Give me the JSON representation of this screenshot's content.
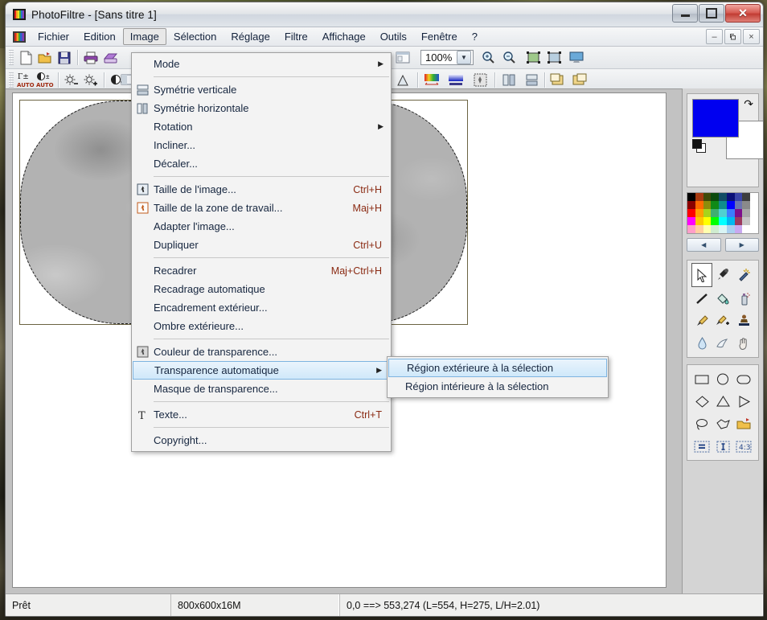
{
  "window": {
    "title": "PhotoFiltre - [Sans titre 1]",
    "logo_icon": "photofiltre-logo-icon",
    "controls": {
      "minimize": "minimize-icon",
      "maximize": "maximize-icon",
      "close": "close-icon"
    }
  },
  "mdi_controls": {
    "minimize": "–",
    "restore": "❐",
    "close": "×"
  },
  "menubar": {
    "items": [
      {
        "label": "Fichier",
        "active": false
      },
      {
        "label": "Edition",
        "active": false
      },
      {
        "label": "Image",
        "active": true
      },
      {
        "label": "Sélection",
        "active": false
      },
      {
        "label": "Réglage",
        "active": false
      },
      {
        "label": "Filtre",
        "active": false
      },
      {
        "label": "Affichage",
        "active": false
      },
      {
        "label": "Outils",
        "active": false
      },
      {
        "label": "Fenêtre",
        "active": false
      },
      {
        "label": "?",
        "active": false
      }
    ]
  },
  "toolbar_top": {
    "icons": [
      "new-file-icon",
      "open-folder-icon",
      "save-floppy-icon",
      "print-icon",
      "scanner-icon",
      "copy-icon",
      "paste-icon",
      "undo-icon",
      "redo-icon",
      "thumbnail-browser-icon"
    ],
    "zoom": {
      "value": "100%",
      "placeholder": "100%",
      "dropdown_icon": "chevron-down-icon"
    },
    "zoom_icons": [
      "zoom-in-icon",
      "zoom-out-icon",
      "fit-image-icon",
      "actual-size-icon",
      "fullscreen-icon"
    ]
  },
  "toolbar_bottom": {
    "icons": [
      "auto-levels-icon",
      "auto-contrast-icon",
      "brightness-down-icon",
      "brightness-up-icon",
      "contrast-icon",
      "grayscale-icon",
      "histogram-icon",
      "gradient-icon",
      "transparency-icon",
      "flip-horizontal-icon",
      "flip-vertical-icon",
      "rotate-left-icon",
      "rotate-right-icon"
    ]
  },
  "menu": {
    "title": "Image",
    "items": [
      {
        "label": "Mode",
        "icon": "",
        "accel": "",
        "submenu": true,
        "highlighted": false,
        "separator_after": true
      },
      {
        "label": "Symétrie verticale",
        "icon": "flip-vertical-icon",
        "accel": "",
        "submenu": false,
        "highlighted": false
      },
      {
        "label": "Symétrie horizontale",
        "icon": "flip-horizontal-icon",
        "accel": "",
        "submenu": false,
        "highlighted": false
      },
      {
        "label": "Rotation",
        "icon": "",
        "accel": "",
        "submenu": true,
        "highlighted": false
      },
      {
        "label": "Incliner...",
        "icon": "",
        "accel": "",
        "submenu": false,
        "highlighted": false
      },
      {
        "label": "Décaler...",
        "icon": "",
        "accel": "",
        "submenu": false,
        "highlighted": false,
        "separator_after": true
      },
      {
        "label": "Taille de l'image...",
        "icon": "image-size-icon",
        "accel": "Ctrl+H",
        "submenu": false,
        "highlighted": false
      },
      {
        "label": "Taille de la zone de travail...",
        "icon": "canvas-size-icon",
        "accel": "Maj+H",
        "submenu": false,
        "highlighted": false
      },
      {
        "label": "Adapter l'image...",
        "icon": "",
        "accel": "",
        "submenu": false,
        "highlighted": false
      },
      {
        "label": "Dupliquer",
        "icon": "",
        "accel": "Ctrl+U",
        "submenu": false,
        "highlighted": false,
        "separator_after": true
      },
      {
        "label": "Recadrer",
        "icon": "",
        "accel": "Maj+Ctrl+H",
        "submenu": false,
        "highlighted": false
      },
      {
        "label": "Recadrage automatique",
        "icon": "",
        "accel": "",
        "submenu": false,
        "highlighted": false
      },
      {
        "label": "Encadrement extérieur...",
        "icon": "",
        "accel": "",
        "submenu": false,
        "highlighted": false
      },
      {
        "label": "Ombre extérieure...",
        "icon": "",
        "accel": "",
        "submenu": false,
        "highlighted": false,
        "separator_after": true
      },
      {
        "label": "Couleur de transparence...",
        "icon": "transparency-color-icon",
        "accel": "",
        "submenu": false,
        "highlighted": false
      },
      {
        "label": "Transparence automatique",
        "icon": "",
        "accel": "",
        "submenu": true,
        "highlighted": true
      },
      {
        "label": "Masque de transparence...",
        "icon": "",
        "accel": "",
        "submenu": false,
        "highlighted": false,
        "separator_after": true
      },
      {
        "label": "Texte...",
        "icon": "text-tool-icon",
        "accel": "Ctrl+T",
        "submenu": false,
        "highlighted": false,
        "separator_after": true
      },
      {
        "label": "Copyright...",
        "icon": "",
        "accel": "",
        "submenu": false,
        "highlighted": false
      }
    ]
  },
  "submenu": {
    "parent": "Transparence automatique",
    "items": [
      {
        "label": "Région extérieure à la sélection",
        "highlighted": true
      },
      {
        "label": "Région intérieure à la sélection",
        "highlighted": false
      }
    ]
  },
  "colors": {
    "foreground": "#0000f0",
    "background": "#ffffff",
    "menu_highlight": "#cfe8fa",
    "menu_highlight_border": "#7eb4e0",
    "accel_text": "#8a2a12",
    "swap_icon": "swap-colors-icon",
    "reset_icon": "default-colors-icon",
    "palette": [
      "#000000",
      "#a83a10",
      "#3f4a08",
      "#0b4a0b",
      "#114c64",
      "#0b1078",
      "#3a44a8",
      "#3d3d3d",
      "#ffffff",
      "#8b0000",
      "#ff6a00",
      "#8d8d0b",
      "#0f8a16",
      "#0f8c8c",
      "#0000ff",
      "#6b74b0",
      "#8a8a8a",
      "#ffffff",
      "#ff0000",
      "#ffa000",
      "#a8d41b",
      "#3fae72",
      "#4fd0d0",
      "#3b7bff",
      "#7d0f8c",
      "#a8a8a8",
      "#ffffff",
      "#ff00ff",
      "#ffc800",
      "#ffff00",
      "#00ff00",
      "#00ffff",
      "#00b8f0",
      "#9c3a5f",
      "#c6c6c6",
      "#ffffff",
      "#ff9ec8",
      "#ffcfa0",
      "#ffffae",
      "#cfeccf",
      "#d9f4f4",
      "#a8cff0",
      "#c8a8f0",
      "#ffffff",
      "#ffffff"
    ],
    "nav_prev_icon": "arrow-left-icon",
    "nav_next_icon": "arrow-right-icon"
  },
  "tools": {
    "items": [
      {
        "name": "selection-arrow-tool",
        "glyph": "↖",
        "selected": true
      },
      {
        "name": "eyedropper-tool",
        "glyph": "✒",
        "selected": false
      },
      {
        "name": "magic-wand-tool",
        "glyph": "✨",
        "selected": false
      },
      {
        "name": "line-tool",
        "glyph": "╱",
        "selected": false
      },
      {
        "name": "paint-bucket-tool",
        "glyph": "◢",
        "selected": false
      },
      {
        "name": "spray-can-tool",
        "glyph": "▓",
        "selected": false
      },
      {
        "name": "paintbrush-tool",
        "glyph": "✐",
        "selected": false
      },
      {
        "name": "advanced-brush-tool",
        "glyph": "✐",
        "selected": false
      },
      {
        "name": "clone-stamp-tool",
        "glyph": "☗",
        "selected": false
      },
      {
        "name": "blur-drop-tool",
        "glyph": "●",
        "selected": false
      },
      {
        "name": "smudge-tool",
        "glyph": "✿",
        "selected": false
      },
      {
        "name": "hand-tool",
        "glyph": "✋",
        "selected": false
      }
    ]
  },
  "shapes": {
    "items": [
      {
        "name": "rectangle-selection-shape",
        "selected": false
      },
      {
        "name": "ellipse-selection-shape",
        "selected": false
      },
      {
        "name": "rounded-rect-selection-shape",
        "selected": false
      },
      {
        "name": "diamond-selection-shape",
        "selected": false
      },
      {
        "name": "triangle-selection-shape",
        "selected": false
      },
      {
        "name": "right-triangle-selection-shape",
        "selected": false
      },
      {
        "name": "lasso-selection-shape",
        "selected": false
      },
      {
        "name": "polygon-selection-shape",
        "selected": false
      },
      {
        "name": "load-selection-icon",
        "selected": false
      },
      {
        "name": "selection-equalize-icon",
        "selected": false
      },
      {
        "name": "selection-invert-icon",
        "selected": false
      },
      {
        "name": "selection-ratio-icon",
        "label": "4:3",
        "selected": false
      }
    ]
  },
  "canvas": {
    "image_name": "Sans titre 1",
    "selection_shape": "rounded-rectangle"
  },
  "statusbar": {
    "state": "Prêt",
    "image_info": "800x600x16M",
    "coords": "0,0 ==> 553,274 (L=554, H=275, L/H=2.01)"
  }
}
